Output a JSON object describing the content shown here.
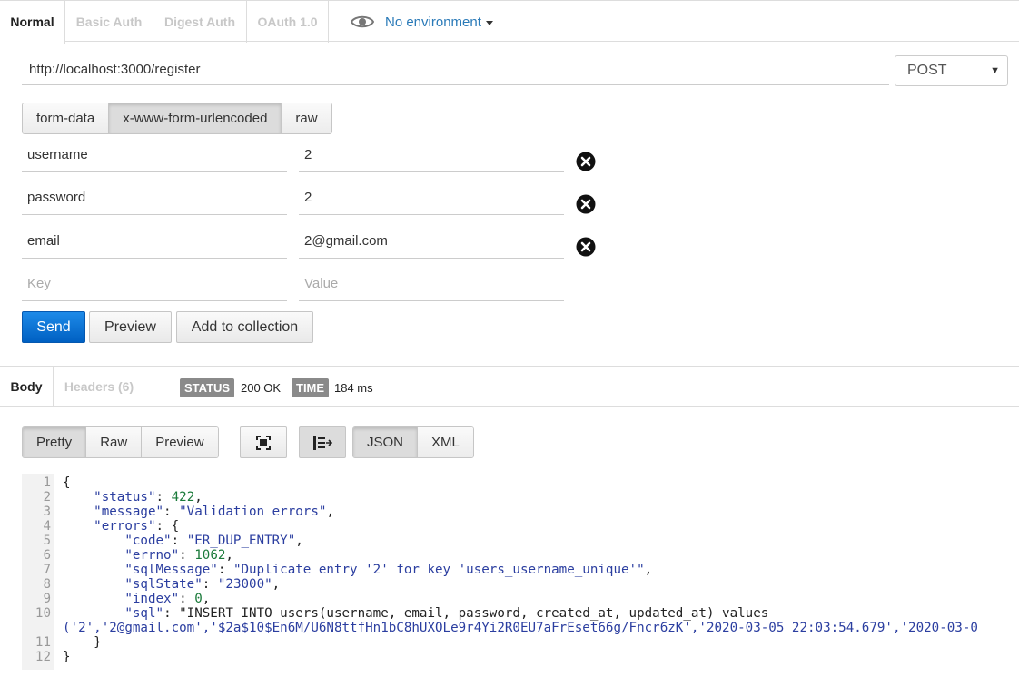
{
  "auth_tabs": [
    "Normal",
    "Basic Auth",
    "Digest Auth",
    "OAuth 1.0"
  ],
  "environment": {
    "label": "No environment",
    "icon": "eye-icon"
  },
  "request": {
    "url": "http://localhost:3000/register",
    "method": "POST",
    "body_types": [
      "form-data",
      "x-www-form-urlencoded",
      "raw"
    ],
    "active_body_type": "x-www-form-urlencoded",
    "params": [
      {
        "key": "username",
        "value": "2"
      },
      {
        "key": "password",
        "value": "2"
      },
      {
        "key": "email",
        "value": "2@gmail.com"
      }
    ],
    "key_placeholder": "Key",
    "value_placeholder": "Value"
  },
  "actions": {
    "send": "Send",
    "preview": "Preview",
    "add": "Add to collection"
  },
  "response": {
    "tabs": [
      "Body",
      "Headers (6)"
    ],
    "status_label": "STATUS",
    "status_value": "200 OK",
    "time_label": "TIME",
    "time_value": "184 ms",
    "view_modes": [
      "Pretty",
      "Raw",
      "Preview"
    ],
    "formats": [
      "JSON",
      "XML"
    ],
    "lines": [
      "{",
      "    \"status\": 422,",
      "    \"message\": \"Validation errors\",",
      "    \"errors\": {",
      "        \"code\": \"ER_DUP_ENTRY\",",
      "        \"errno\": 1062,",
      "        \"sqlMessage\": \"Duplicate entry '2' for key 'users_username_unique'\",",
      "        \"sqlState\": \"23000\",",
      "        \"index\": 0,",
      "        \"sql\": \"INSERT INTO users(username, email, password, created_at, updated_at) values",
      "('2','2@gmail.com','$2a$10$En6M/U6N8ttfHn1bC8hUXOLe9r4Yi2R0EU7aFrEset66g/Fncr6zK','2020-03-05 22:03:54.679','2020-03-0",
      "    }",
      "}"
    ],
    "line_numbers": [
      "1",
      "2",
      "3",
      "4",
      "5",
      "6",
      "7",
      "8",
      "9",
      "10",
      "",
      "11",
      "12"
    ]
  },
  "colors": {
    "accent": "#2a7ab8",
    "send": "#0a6fd6",
    "badge": "#8a8a8a"
  }
}
